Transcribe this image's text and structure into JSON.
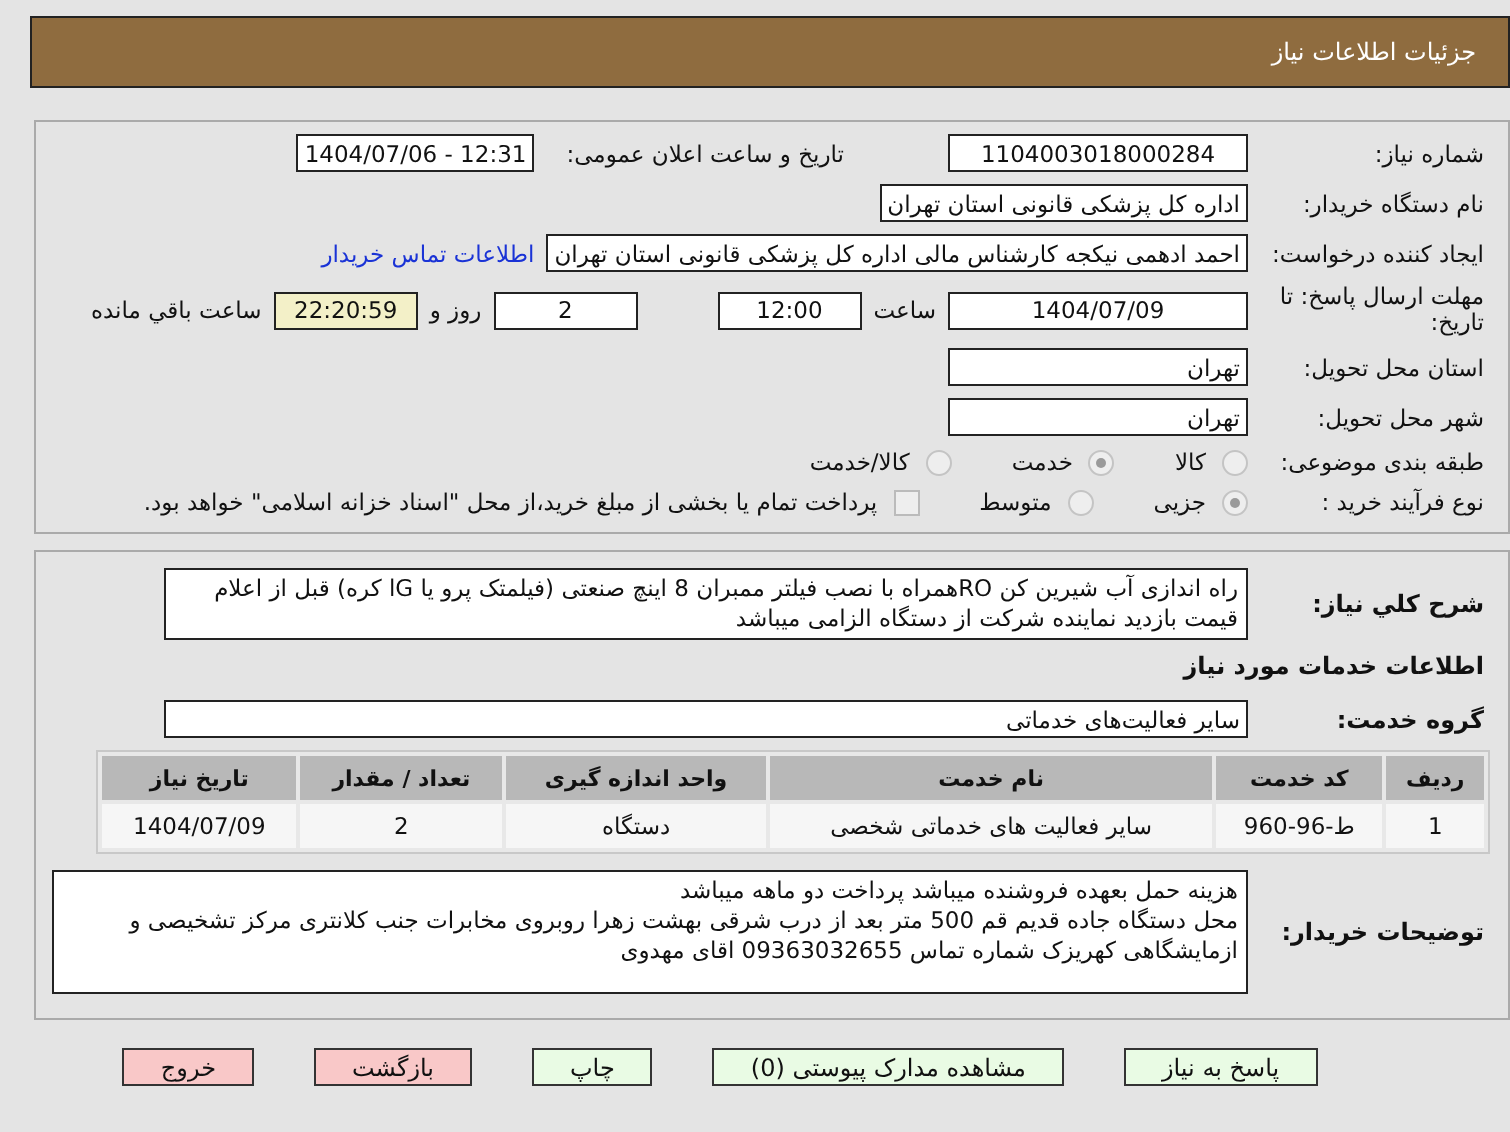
{
  "header": {
    "title": "جزئیات اطلاعات نیاز"
  },
  "need_number": {
    "label": "شماره نیاز:",
    "value": "1104003018000284"
  },
  "announce": {
    "label": "تاریخ و ساعت اعلان عمومی:",
    "value": "1404/07/06 - 12:31"
  },
  "buyer_org": {
    "label": "نام دستگاه خریدار:",
    "value": "اداره کل پزشکی قانونی استان تهران"
  },
  "requester": {
    "label": "ایجاد کننده درخواست:",
    "value": "احمد ادهمی نیکجه کارشناس مالی اداره کل پزشکی قانونی استان تهران",
    "link": "اطلاعات تماس خریدار"
  },
  "deadline": {
    "label": "مهلت ارسال پاسخ: تا تاریخ:",
    "date": "1404/07/09",
    "time_label": "ساعت",
    "time": "12:00",
    "days": "2",
    "days_label": "روز و",
    "remaining": "22:20:59",
    "remaining_label": "ساعت باقي مانده"
  },
  "province": {
    "label": "استان محل تحویل:",
    "value": "تهران"
  },
  "city": {
    "label": "شهر محل تحویل:",
    "value": "تهران"
  },
  "category": {
    "label": "طبقه بندی موضوعی:",
    "options": [
      {
        "kind": "radio",
        "label": "کالا",
        "selected": false
      },
      {
        "kind": "radio",
        "label": "خدمت",
        "selected": true
      },
      {
        "kind": "radio",
        "label": "کالا/خدمت",
        "selected": false
      }
    ]
  },
  "process": {
    "label": "نوع فرآیند خرید :",
    "options": [
      {
        "kind": "radio",
        "label": "جزیی",
        "selected": true
      },
      {
        "kind": "radio",
        "label": "متوسط",
        "selected": false
      },
      {
        "kind": "checkbox",
        "label": "پرداخت تمام یا بخشی از مبلغ خرید،از محل \"اسناد خزانه اسلامی\" خواهد بود.",
        "selected": false
      }
    ]
  },
  "description": {
    "label": "شرح کلي نیاز:",
    "value": "راه اندازی  آب شیرین کن ROهمراه با نصب فیلتر ممبران 8 اینچ صنعتی (فیلمتک پرو یا lG کره) قبل از اعلام قیمت بازدید نماینده شرکت از دستگاه الزامی میباشد"
  },
  "services_title": "اطلاعات خدمات مورد نیاز",
  "service_group": {
    "label": "گروه خدمت:",
    "value": "سایر فعالیت‌های خدماتی"
  },
  "table": {
    "columns": [
      "ردیف",
      "کد خدمت",
      "نام خدمت",
      "واحد اندازه گیری",
      "تعداد / مقدار",
      "تاریخ نیاز"
    ],
    "rows": [
      [
        "1",
        "ط-96-960",
        "سایر فعالیت های خدماتی شخصی",
        "دستگاه",
        "2",
        "1404/07/09"
      ]
    ]
  },
  "buyer_notes": {
    "label": "توضیحات خریدار:",
    "lines": [
      "هزینه حمل بعهده فروشنده میباشد پرداخت دو ماهه میباشد",
      "محل دستگاه جاده قدیم قم 500 متر بعد از درب شرقی بهشت زهرا روبروی مخابرات جنب کلانتری مرکز تشخیصی و ازمایشگاهی کهریزک شماره تماس 09363032655 اقای مهدوی"
    ]
  },
  "buttons": [
    {
      "label": "پاسخ به نیاز",
      "kind": "go"
    },
    {
      "label": "مشاهده مدارک پیوستی (0)",
      "kind": "go"
    },
    {
      "label": "چاپ",
      "kind": "go"
    },
    {
      "label": "بازگشت",
      "kind": "stop"
    },
    {
      "label": "خروج",
      "kind": "stop"
    }
  ]
}
